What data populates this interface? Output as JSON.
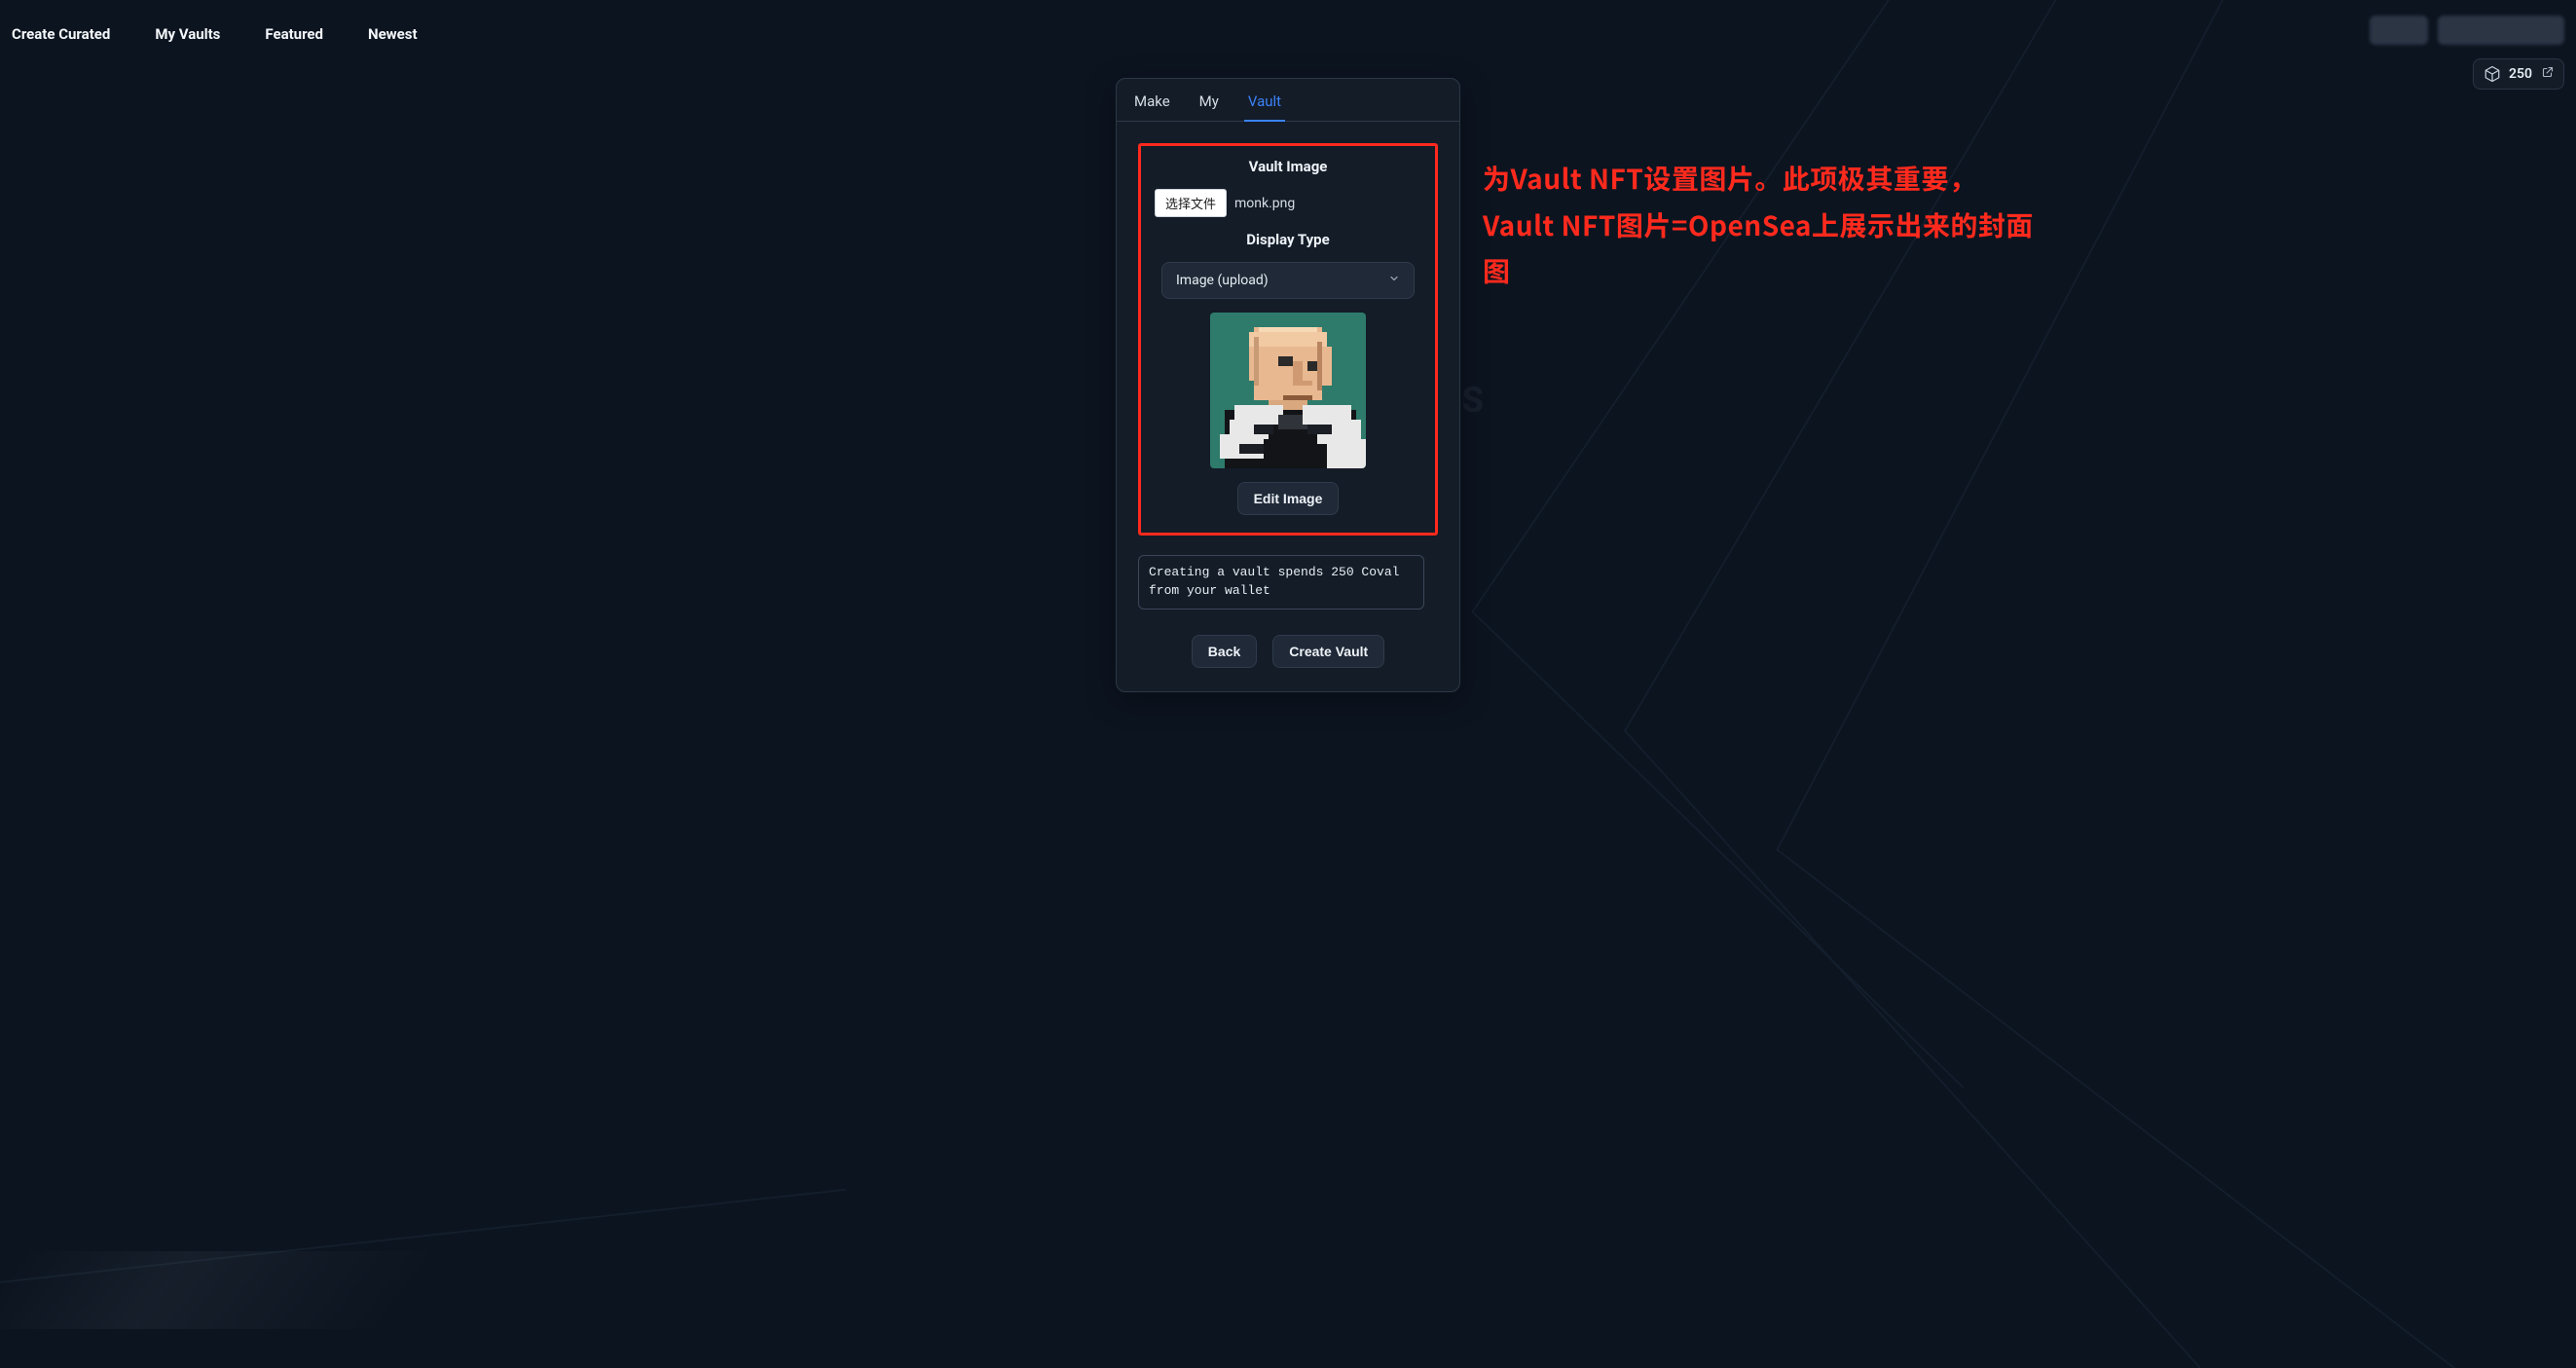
{
  "nav": {
    "items": [
      {
        "label": "Create Curated"
      },
      {
        "label": "My Vaults"
      },
      {
        "label": "Featured"
      },
      {
        "label": "Newest"
      }
    ]
  },
  "coval_badge": {
    "amount": "250"
  },
  "card": {
    "tabs": [
      {
        "label": "Make",
        "active": false
      },
      {
        "label": "My",
        "active": false
      },
      {
        "label": "Vault",
        "active": true
      }
    ],
    "vault_image_label": "Vault Image",
    "file_button": "选择文件",
    "file_name": "monk.png",
    "display_type_label": "Display Type",
    "display_type_value": "Image (upload)",
    "edit_image_label": "Edit Image",
    "notice": "Creating a vault spends 250 Coval from your wallet",
    "back_label": "Back",
    "create_label": "Create Vault"
  },
  "annotation": {
    "text": "为Vault NFT设置图片。此项极其重要，Vault NFT图片=OpenSea上展示出来的封面图"
  },
  "ghost_text": "KBEATS"
}
